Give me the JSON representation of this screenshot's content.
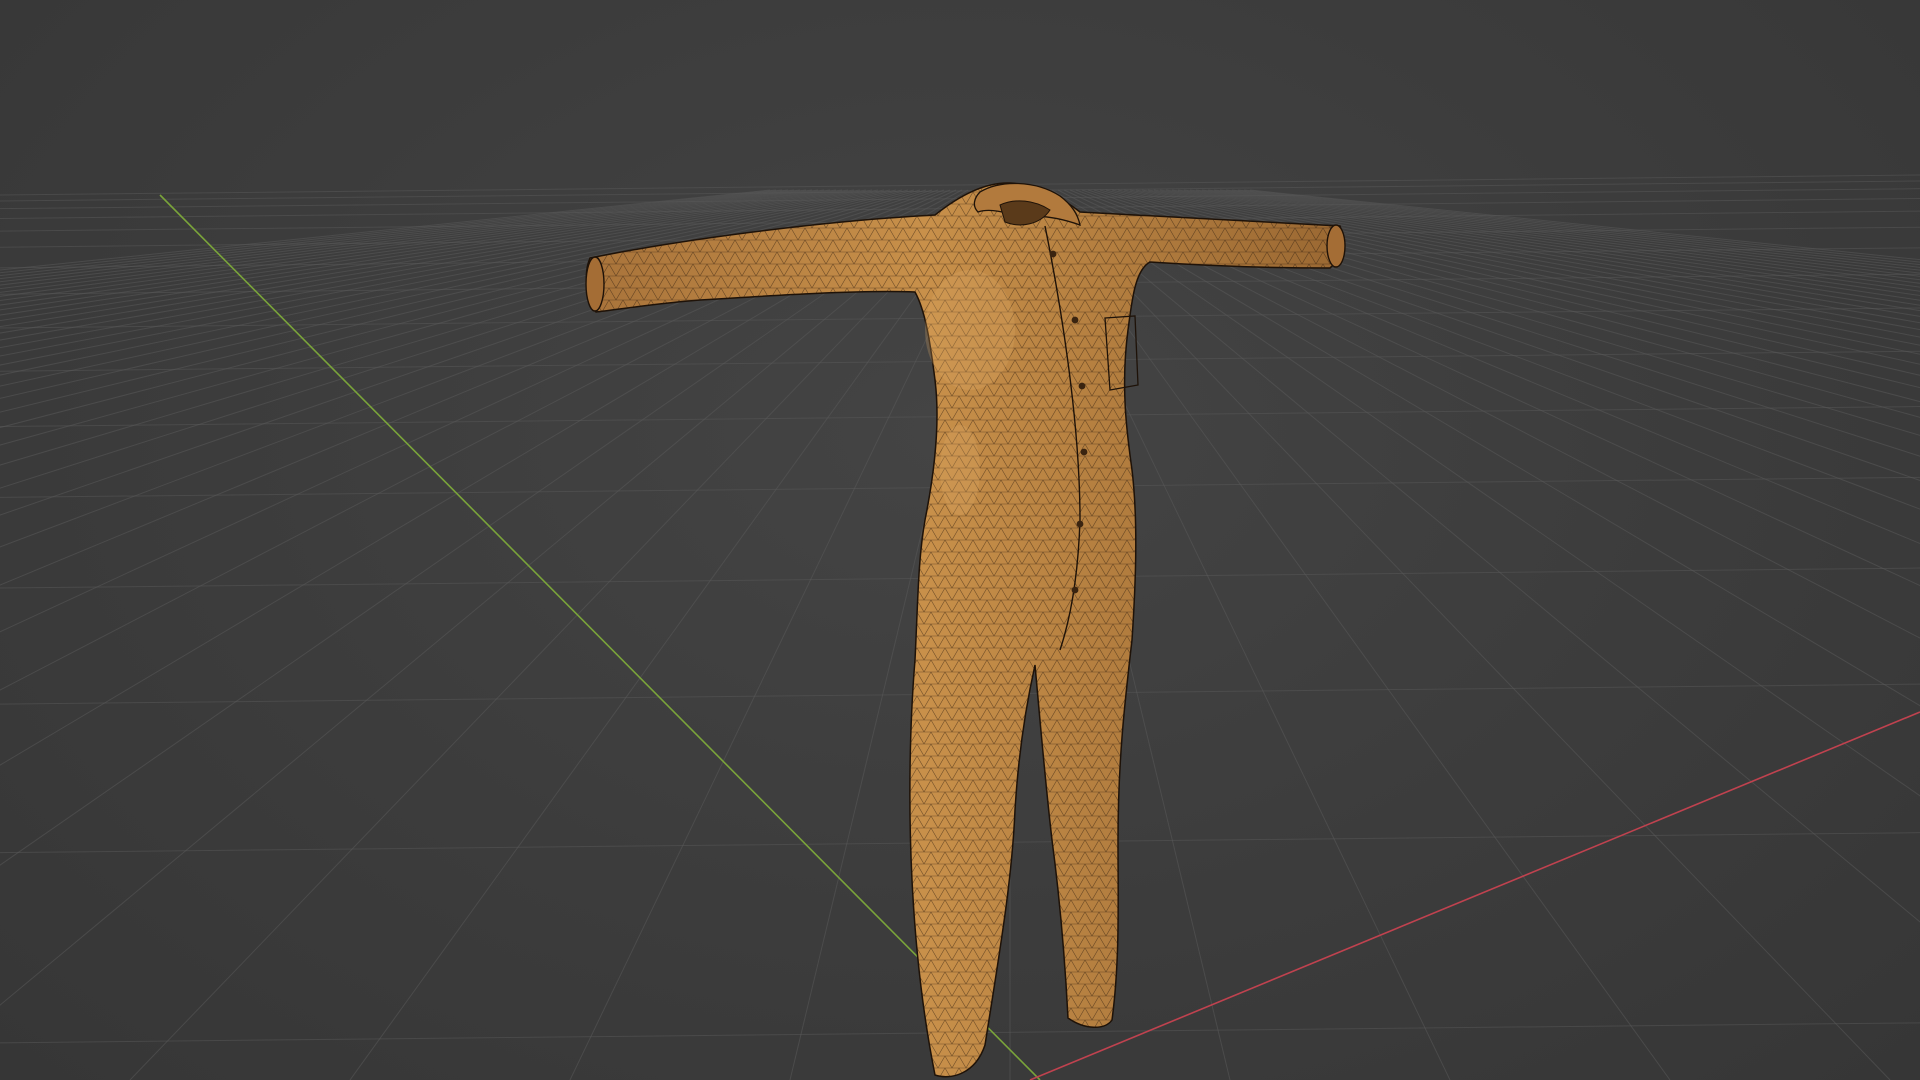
{
  "viewport": {
    "background_color": "#3d3d3d",
    "grid_color": "#5a5a5a",
    "axis_x_color": "#c0424f",
    "axis_y_color": "#7aa43a",
    "mesh_fill_color": "#c8904a",
    "mesh_wire_color": "#2a1a0c"
  },
  "scene": {
    "object_type": "mesh",
    "object_description_icon": "garment-mesh-icon",
    "shading": "solid-with-wireframe"
  }
}
